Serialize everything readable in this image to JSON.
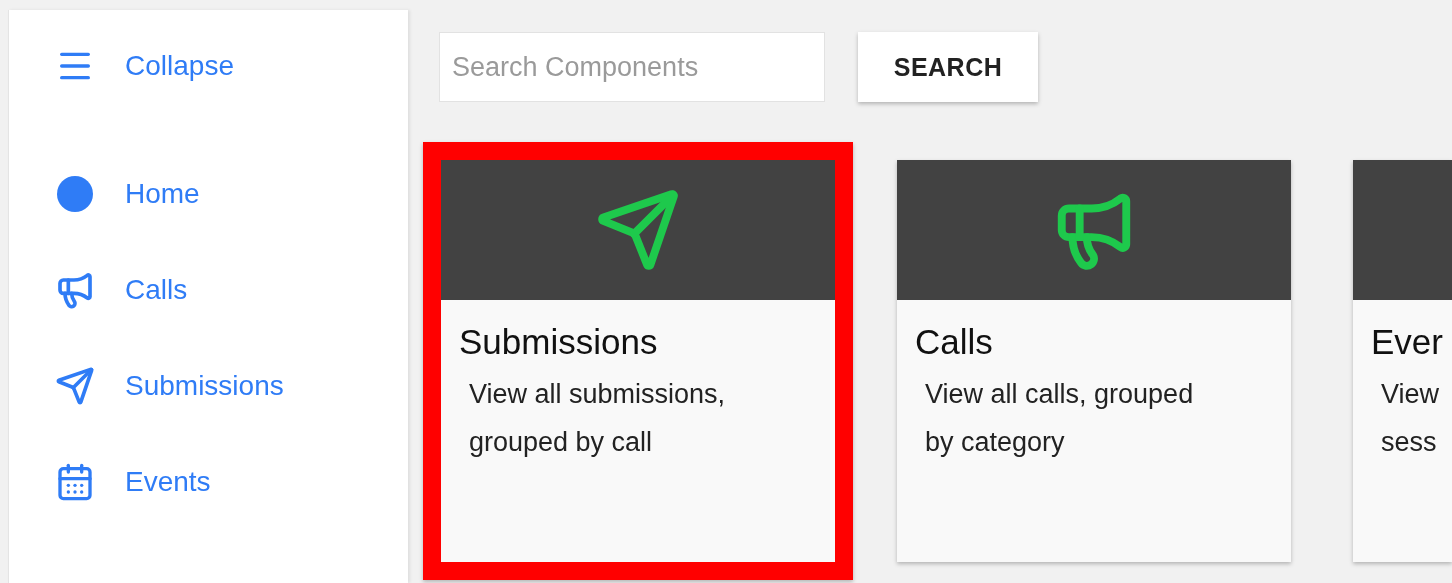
{
  "sidebar": {
    "collapse": {
      "label": "Collapse"
    },
    "items": [
      {
        "label": "Home",
        "kind": "circle"
      },
      {
        "label": "Calls",
        "kind": "megaphone"
      },
      {
        "label": "Submissions",
        "kind": "plane"
      },
      {
        "label": "Events",
        "kind": "calendar"
      }
    ]
  },
  "search": {
    "placeholder": "Search Components",
    "button": "SEARCH"
  },
  "cards": [
    {
      "title": "Submissions",
      "description": [
        "View all submissions,",
        "grouped by call"
      ],
      "kind": "plane",
      "highlighted": true
    },
    {
      "title": "Calls",
      "description": [
        "View all calls, grouped",
        "by category"
      ],
      "kind": "megaphone",
      "highlighted": false
    },
    {
      "title": "Ever",
      "description": [
        "View",
        "sess"
      ],
      "kind": "blank",
      "highlighted": false
    }
  ]
}
